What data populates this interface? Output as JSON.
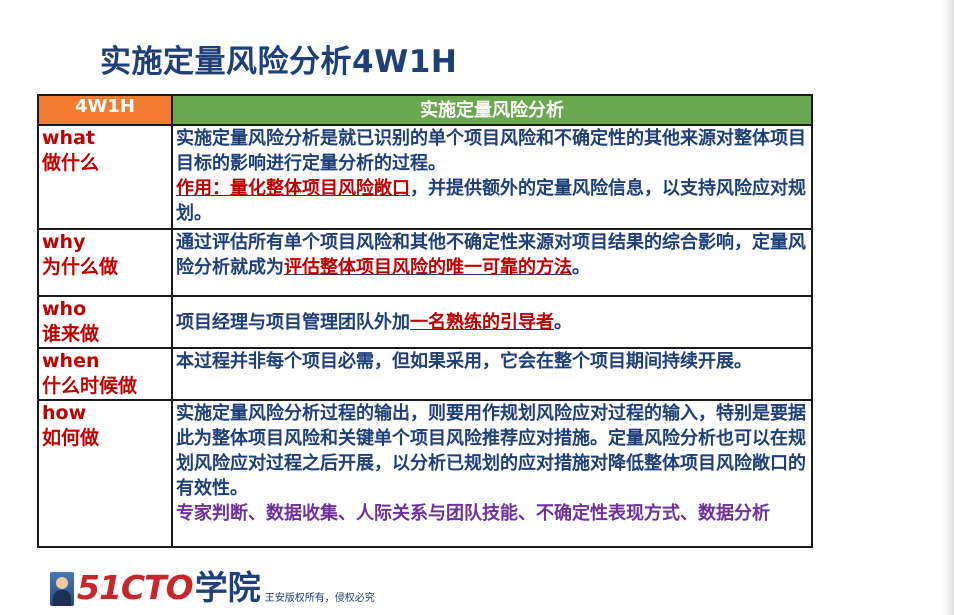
{
  "title": "实施定量风险分析4W1H",
  "table": {
    "header": [
      "4W1H",
      "实施定量风险分析"
    ],
    "rows": [
      {
        "q_en": "what",
        "q_cn": "做什么",
        "answer": [
          {
            "text": "实施定量风险分析是就已识别的单个项目风险和不确定性的其他来源对整体项目目标的影响进行定量分析的过程。",
            "style": "normal"
          },
          {
            "text": "作用：量化整体项目风险敞口",
            "style": "highlight",
            "break_before": true
          },
          {
            "text": "，并提供额外的定量风险信息，以支持风险应对规划。",
            "style": "normal"
          }
        ]
      },
      {
        "q_en": "why",
        "q_cn": "为什么做",
        "answer": [
          {
            "text": "通过评估所有单个项目风险和其他不确定性来源对项目结果的综合影响，定量风险分析就成为",
            "style": "normal"
          },
          {
            "text": "评估整体项目风险的唯一可靠的方法",
            "style": "highlight"
          },
          {
            "text": "。",
            "style": "normal"
          }
        ]
      },
      {
        "q_en": "who",
        "q_cn": "谁来做",
        "answer": [
          {
            "text": "项目经理与项目管理团队外加",
            "style": "normal"
          },
          {
            "text": "一名熟练的引导者",
            "style": "highlight"
          },
          {
            "text": "。",
            "style": "normal"
          }
        ]
      },
      {
        "q_en": "when",
        "q_cn": "什么时候做",
        "answer": [
          {
            "text": "本过程并非每个项目必需，但如果采用，它会在整个项目期间持续开展。",
            "style": "normal"
          }
        ]
      },
      {
        "q_en": "how",
        "q_cn": "如何做",
        "answer": [
          {
            "text": "实施定量风险分析过程的输出，则要用作规划风险应对过程的输入，特别是要据此为整体项目风险和关键单个项目风险推荐应对措施。定量风险分析也可以在规划风险应对过程之后开展，以分析已规划的应对措施对降低整体项目风险敞口的有效性。",
            "style": "normal"
          },
          {
            "text": "专家判断、数据收集、人际关系与团队技能、不确定性表现方式、数据分析",
            "style": "purple",
            "break_before": true
          }
        ]
      }
    ]
  },
  "footer": {
    "brand_num": "51CTO",
    "brand_cn": "学院",
    "copyright": "王安版权所有，侵权必究"
  },
  "colors": {
    "title": "#1f3f7a",
    "header_left_bg": "#f47c30",
    "header_right_bg": "#6aa84f",
    "question_text": "#c00000",
    "answer_text": "#1f3f7a",
    "highlight": "#c00000",
    "tools_text": "#7030a0",
    "brand_red": "#c9262c"
  }
}
